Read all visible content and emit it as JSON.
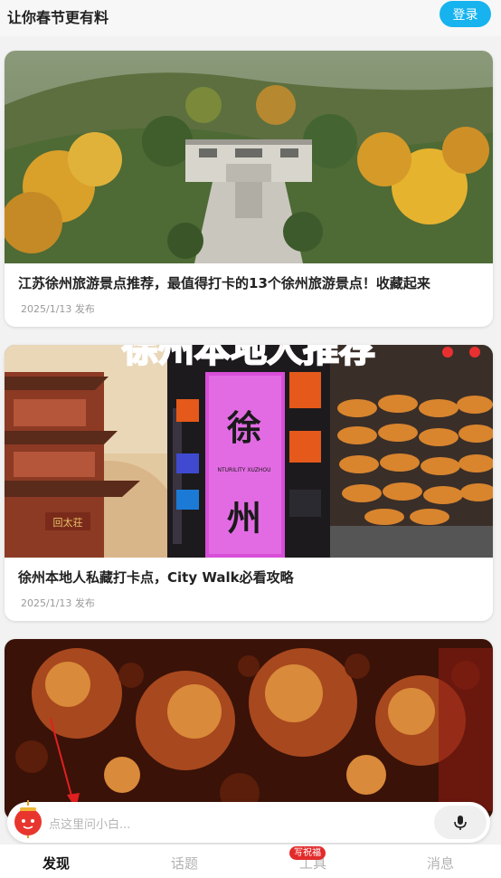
{
  "header": {
    "title": "让你春节更有料",
    "login_label": "登录"
  },
  "feed": [
    {
      "title": "江苏徐州旅游景点推荐，最值得打卡的13个徐州旅游景点！收藏起来",
      "date": "2025/1/13 发布"
    },
    {
      "title": "徐州本地人私藏打卡点，City Walk必看攻略",
      "date": "2025/1/13 发布",
      "banner_text": "徐州本地人推荐",
      "sign_text": "徐州",
      "sign_sub": "NTURILITY XUZHOU",
      "gate_text": "回太荘"
    },
    {
      "title": "",
      "date": ""
    }
  ],
  "search": {
    "placeholder": "点这里问小白..."
  },
  "tabs": [
    {
      "label": "发现",
      "active": true
    },
    {
      "label": "话题",
      "active": false
    },
    {
      "label": "工具",
      "active": false
    },
    {
      "label": "消息",
      "active": false
    }
  ],
  "tools_badge": "写祝福",
  "colors": {
    "accent": "#16b3ef",
    "badge_red": "#e32b2b"
  }
}
